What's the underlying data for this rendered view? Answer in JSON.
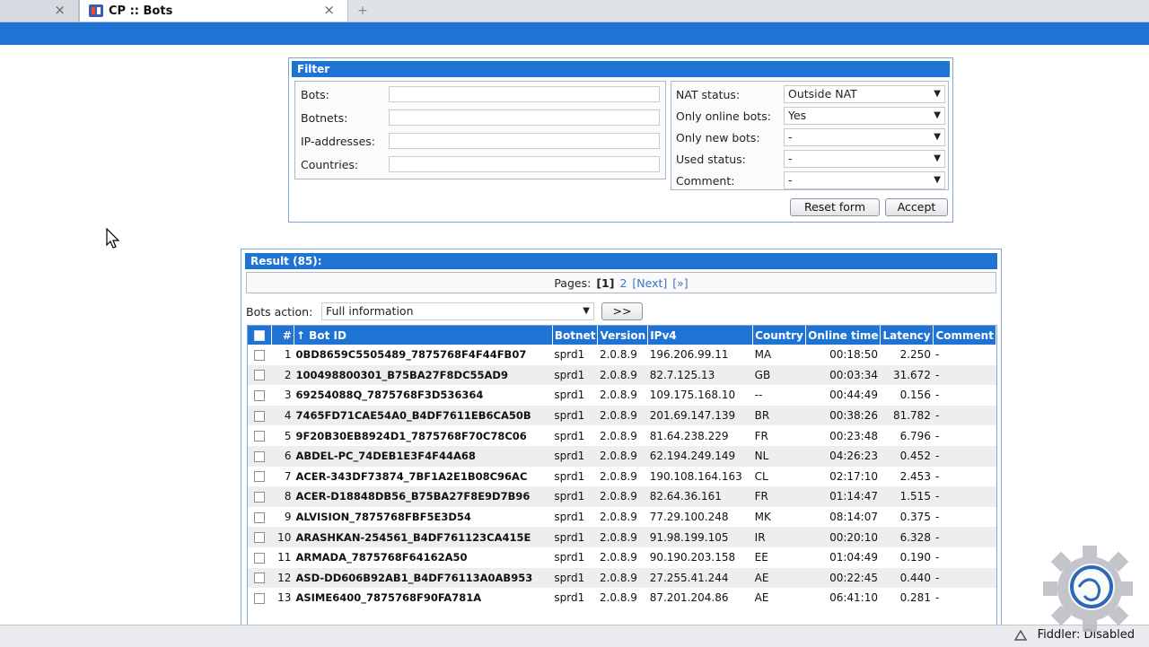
{
  "browser": {
    "active_tab_title": "CP :: Bots",
    "close_glyph": "×",
    "newtab_glyph": "+"
  },
  "filter": {
    "title": "Filter",
    "left_fields": [
      {
        "label": "Bots:",
        "value": ""
      },
      {
        "label": "Botnets:",
        "value": ""
      },
      {
        "label": "IP-addresses:",
        "value": ""
      },
      {
        "label": "Countries:",
        "value": ""
      }
    ],
    "right_fields": [
      {
        "label": "NAT status:",
        "value": "Outside NAT"
      },
      {
        "label": "Only online bots:",
        "value": "Yes"
      },
      {
        "label": "Only new bots:",
        "value": "-"
      },
      {
        "label": "Used status:",
        "value": "-"
      },
      {
        "label": "Comment:",
        "value": "-"
      }
    ],
    "reset_label": "Reset form",
    "accept_label": "Accept"
  },
  "result": {
    "title": "Result (85):",
    "pages_label": "Pages:",
    "page_current": "[1]",
    "page_2": "2",
    "page_next": "[Next]",
    "page_last": "[»]",
    "bots_action_label": "Bots action:",
    "bots_action_value": "Full information",
    "go_label": ">>",
    "columns": [
      "#",
      "↑ Bot ID",
      "Botnet",
      "Version",
      "IPv4",
      "Country",
      "Online time",
      "Latency",
      "Comment"
    ],
    "rows": [
      {
        "n": "1",
        "id": "0BD8659C5505489_7875768F4F44FB07",
        "botnet": "sprd1",
        "ver": "2.0.8.9",
        "ip": "196.206.99.11",
        "country": "MA",
        "online": "00:18:50",
        "latency": "2.250",
        "comment": "-"
      },
      {
        "n": "2",
        "id": "100498800301_B75BA27F8DC55AD9",
        "botnet": "sprd1",
        "ver": "2.0.8.9",
        "ip": "82.7.125.13",
        "country": "GB",
        "online": "00:03:34",
        "latency": "31.672",
        "comment": "-"
      },
      {
        "n": "3",
        "id": "69254088Q_7875768F3D536364",
        "botnet": "sprd1",
        "ver": "2.0.8.9",
        "ip": "109.175.168.10",
        "country": "--",
        "online": "00:44:49",
        "latency": "0.156",
        "comment": "-"
      },
      {
        "n": "4",
        "id": "7465FD71CAE54A0_B4DF7611EB6CA50B",
        "botnet": "sprd1",
        "ver": "2.0.8.9",
        "ip": "201.69.147.139",
        "country": "BR",
        "online": "00:38:26",
        "latency": "81.782",
        "comment": "-"
      },
      {
        "n": "5",
        "id": "9F20B30EB8924D1_7875768F70C78C06",
        "botnet": "sprd1",
        "ver": "2.0.8.9",
        "ip": "81.64.238.229",
        "country": "FR",
        "online": "00:23:48",
        "latency": "6.796",
        "comment": "-"
      },
      {
        "n": "6",
        "id": "ABDEL-PC_74DEB1E3F4F44A68",
        "botnet": "sprd1",
        "ver": "2.0.8.9",
        "ip": "62.194.249.149",
        "country": "NL",
        "online": "04:26:23",
        "latency": "0.452",
        "comment": "-"
      },
      {
        "n": "7",
        "id": "ACER-343DF73874_7BF1A2E1B08C96AC",
        "botnet": "sprd1",
        "ver": "2.0.8.9",
        "ip": "190.108.164.163",
        "country": "CL",
        "online": "02:17:10",
        "latency": "2.453",
        "comment": "-"
      },
      {
        "n": "8",
        "id": "ACER-D18848DB56_B75BA27F8E9D7B96",
        "botnet": "sprd1",
        "ver": "2.0.8.9",
        "ip": "82.64.36.161",
        "country": "FR",
        "online": "01:14:47",
        "latency": "1.515",
        "comment": "-"
      },
      {
        "n": "9",
        "id": "ALVISION_7875768FBF5E3D54",
        "botnet": "sprd1",
        "ver": "2.0.8.9",
        "ip": "77.29.100.248",
        "country": "MK",
        "online": "08:14:07",
        "latency": "0.375",
        "comment": "-"
      },
      {
        "n": "10",
        "id": "ARASHKAN-254561_B4DF761123CA415E",
        "botnet": "sprd1",
        "ver": "2.0.8.9",
        "ip": "91.98.199.105",
        "country": "IR",
        "online": "00:20:10",
        "latency": "6.328",
        "comment": "-"
      },
      {
        "n": "11",
        "id": "ARMADA_7875768F64162A50",
        "botnet": "sprd1",
        "ver": "2.0.8.9",
        "ip": "90.190.203.158",
        "country": "EE",
        "online": "01:04:49",
        "latency": "0.190",
        "comment": "-"
      },
      {
        "n": "12",
        "id": "ASD-DD606B92AB1_B4DF76113A0AB953",
        "botnet": "sprd1",
        "ver": "2.0.8.9",
        "ip": "27.255.41.244",
        "country": "AE",
        "online": "00:22:45",
        "latency": "0.440",
        "comment": "-"
      },
      {
        "n": "13",
        "id": "ASIME6400_7875768F90FA781A",
        "botnet": "sprd1",
        "ver": "2.0.8.9",
        "ip": "87.201.204.86",
        "country": "AE",
        "online": "06:41:10",
        "latency": "0.281",
        "comment": "-"
      }
    ]
  },
  "status": {
    "fiddler": "Fiddler: Disabled"
  }
}
